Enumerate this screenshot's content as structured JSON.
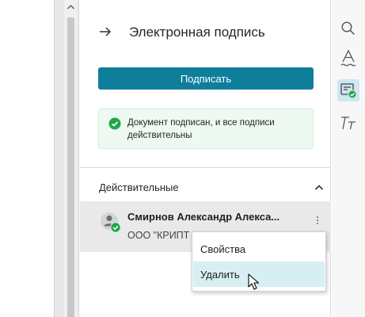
{
  "panel": {
    "title": "Электронная подпись",
    "sign_button_label": "Подписать",
    "status_text": "Документ подписан, и все подписи действительны"
  },
  "section": {
    "title": "Действительные"
  },
  "signer": {
    "name": "Смирнов Александр Алекса...",
    "org": "ООО \"КРИПТ"
  },
  "context_menu": {
    "items": [
      "Свойства",
      "Удалить"
    ],
    "highlighted": "Удалить"
  },
  "rail": {
    "icons": [
      "search-icon",
      "font-style-icon",
      "electronic-signature-icon",
      "text-formatting-icon"
    ],
    "active": "electronic-signature-icon"
  },
  "colors": {
    "accent": "#0f7e9b",
    "success": "#1ea84a",
    "menu_highlight": "#d6eff3"
  }
}
